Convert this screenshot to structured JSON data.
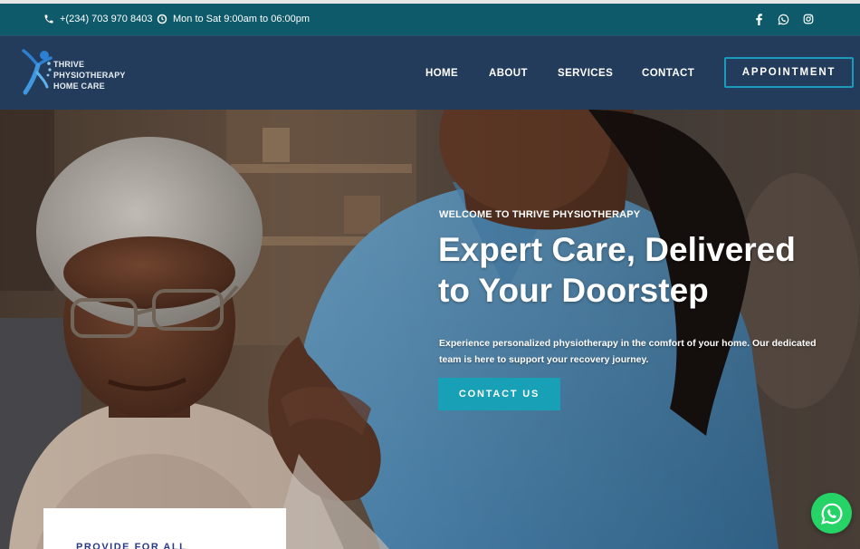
{
  "topbar": {
    "phone": "+(234) 703 970 8403",
    "hours": "Mon to Sat 9:00am to 06:00pm",
    "social": [
      "facebook-icon",
      "whatsapp-icon",
      "instagram-icon"
    ]
  },
  "logo": {
    "line1": "THRIVE",
    "line2": "PHYSIOTHERAPY",
    "line3": "HOME CARE"
  },
  "nav": {
    "items": [
      "HOME",
      "ABOUT",
      "SERVICES",
      "CONTACT"
    ],
    "appointment": "APPOINTMENT"
  },
  "hero": {
    "welcome": "WELCOME TO THRIVE PHYSIOTHERAPY",
    "headline_line1": "Expert Care, Delivered",
    "headline_line2": "to Your Doorstep",
    "description": "Experience personalized physiotherapy in the comfort of your home. Our dedicated team is here to support your recovery journey.",
    "cta": "CONTACT US"
  },
  "card": {
    "title": "PROVIDE FOR ALL"
  },
  "colors": {
    "topbar": "#0e5a6b",
    "nav": "#233c5b",
    "accent": "#18a0b6",
    "whatsapp": "#25d366"
  }
}
